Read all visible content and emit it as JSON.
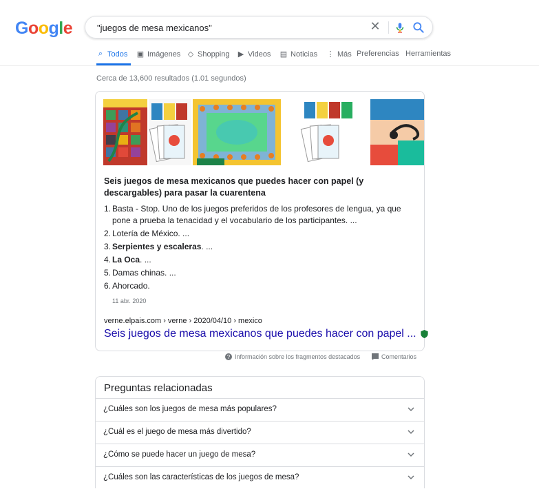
{
  "logo": {
    "letters": [
      "G",
      "o",
      "o",
      "g",
      "l",
      "e"
    ],
    "colors": [
      "#4285f4",
      "#ea4335",
      "#fbbc05",
      "#4285f4",
      "#34a853",
      "#ea4335"
    ]
  },
  "search": {
    "query": "\"juegos de mesa mexicanos\""
  },
  "tabs": [
    {
      "label": "Todos",
      "icon": "search-icon"
    },
    {
      "label": "Imágenes",
      "icon": "image-icon"
    },
    {
      "label": "Shopping",
      "icon": "tag-icon"
    },
    {
      "label": "Videos",
      "icon": "play-icon"
    },
    {
      "label": "Noticias",
      "icon": "news-icon"
    },
    {
      "label": "Más",
      "icon": "dots-icon"
    },
    {
      "label": "Preferencias"
    },
    {
      "label": "Herramientas"
    }
  ],
  "stats": "Cerca de 13,600 resultados (1.01 segundos)",
  "featured": {
    "title": "Seis juegos de mesa mexicanos que puedes hacer con papel (y descargables) para pasar la cuarentena",
    "items": [
      {
        "num": "1.",
        "bold": "",
        "text": "Basta - Stop. Uno de los juegos preferidos de los profesores de lengua, ya que pone a prueba la tenacidad y el vocabulario de los participantes. ..."
      },
      {
        "num": "2.",
        "bold": "",
        "text": "Lotería de México. ..."
      },
      {
        "num": "3.",
        "bold": "Serpientes y escaleras",
        "text": ". ..."
      },
      {
        "num": "4.",
        "bold": "La Oca",
        "text": ". ..."
      },
      {
        "num": "5.",
        "bold": "",
        "text": "Damas chinas. ..."
      },
      {
        "num": "6.",
        "bold": "",
        "text": "Ahorcado."
      }
    ],
    "date": "11 abr. 2020",
    "cite": "verne.elpais.com › verne › 2020/04/10 › mexico",
    "link": "Seis juegos de mesa mexicanos que puedes hacer con papel ...",
    "image_tiles": [
      "serpientes-y-escaleras-board",
      "loteria-cards",
      "la-oca-board",
      "loteria-cards",
      "loteria-card-scorpion"
    ]
  },
  "fs_footer": {
    "info": "Información sobre los fragmentos destacados",
    "feedback": "Comentarios"
  },
  "paa": {
    "title": "Preguntas relacionadas",
    "questions": [
      "¿Cuáles son los juegos de mesa más populares?",
      "¿Cuál es el juego de mesa más divertido?",
      "¿Cómo se puede hacer un juego de mesa?",
      "¿Cuáles son las características de los juegos de mesa?"
    ]
  },
  "colors": {
    "accent": "#1a73e8",
    "link": "#1a0dab",
    "muted": "#70757a"
  }
}
